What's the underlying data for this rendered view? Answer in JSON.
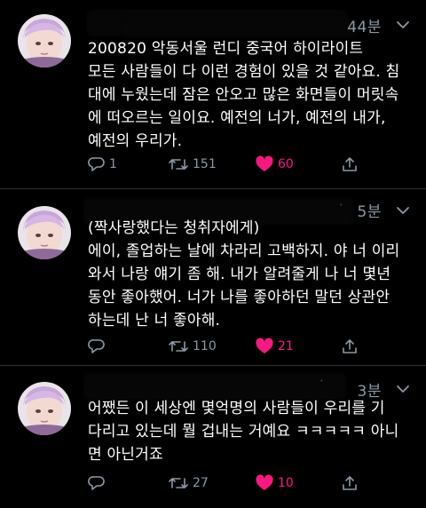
{
  "colors": {
    "background": "#000000",
    "text": "#ffffff",
    "muted": "#8b98a5",
    "like": "#f91880",
    "divider": "#2f3336"
  },
  "tweets": [
    {
      "time": "44분",
      "text_lines": [
        "200820 악동서울 런디 중국어 하이라이트",
        "모든 사람들이 다 이런 경험이 있을 것 같아요. 침",
        "대에 누웠는데 잠은 안오고 많은 화면들이 머릿속",
        "에 떠오르는 일이요. 예전의 너가, 예전의 내가,",
        "예전의 우리가."
      ],
      "reply_count": "1",
      "retweet_count": "151",
      "like_count": "60",
      "liked": true,
      "reply_icon": "reply-icon",
      "retweet_icon": "retweet-icon",
      "like_icon": "heart-icon",
      "share_icon": "share-icon"
    },
    {
      "time": "5분",
      "text_lines": [
        "(짝사랑했다는 청취자에게)",
        "에이, 졸업하는 날에 차라리 고백하지. 야 너 이리",
        "와서 나랑 얘기 좀 해. 내가 알려줄게 나 너 몇년",
        "동안 좋아했어. 너가 나를 좋아하던 말던 상관안",
        "하는데 난 너 좋아해."
      ],
      "reply_count": "",
      "retweet_count": "110",
      "like_count": "21",
      "liked": true
    },
    {
      "time": "3분",
      "text_lines": [
        "어쨌든 이 세상엔  몇억명의 사람들이 우리를 기",
        "다리고 있는데 뭘 겁내는 거예요 ㅋㅋㅋㅋㅋ 아니",
        "면 아닌거죠"
      ],
      "reply_count": "",
      "retweet_count": "27",
      "like_count": "10",
      "liked": true
    }
  ]
}
